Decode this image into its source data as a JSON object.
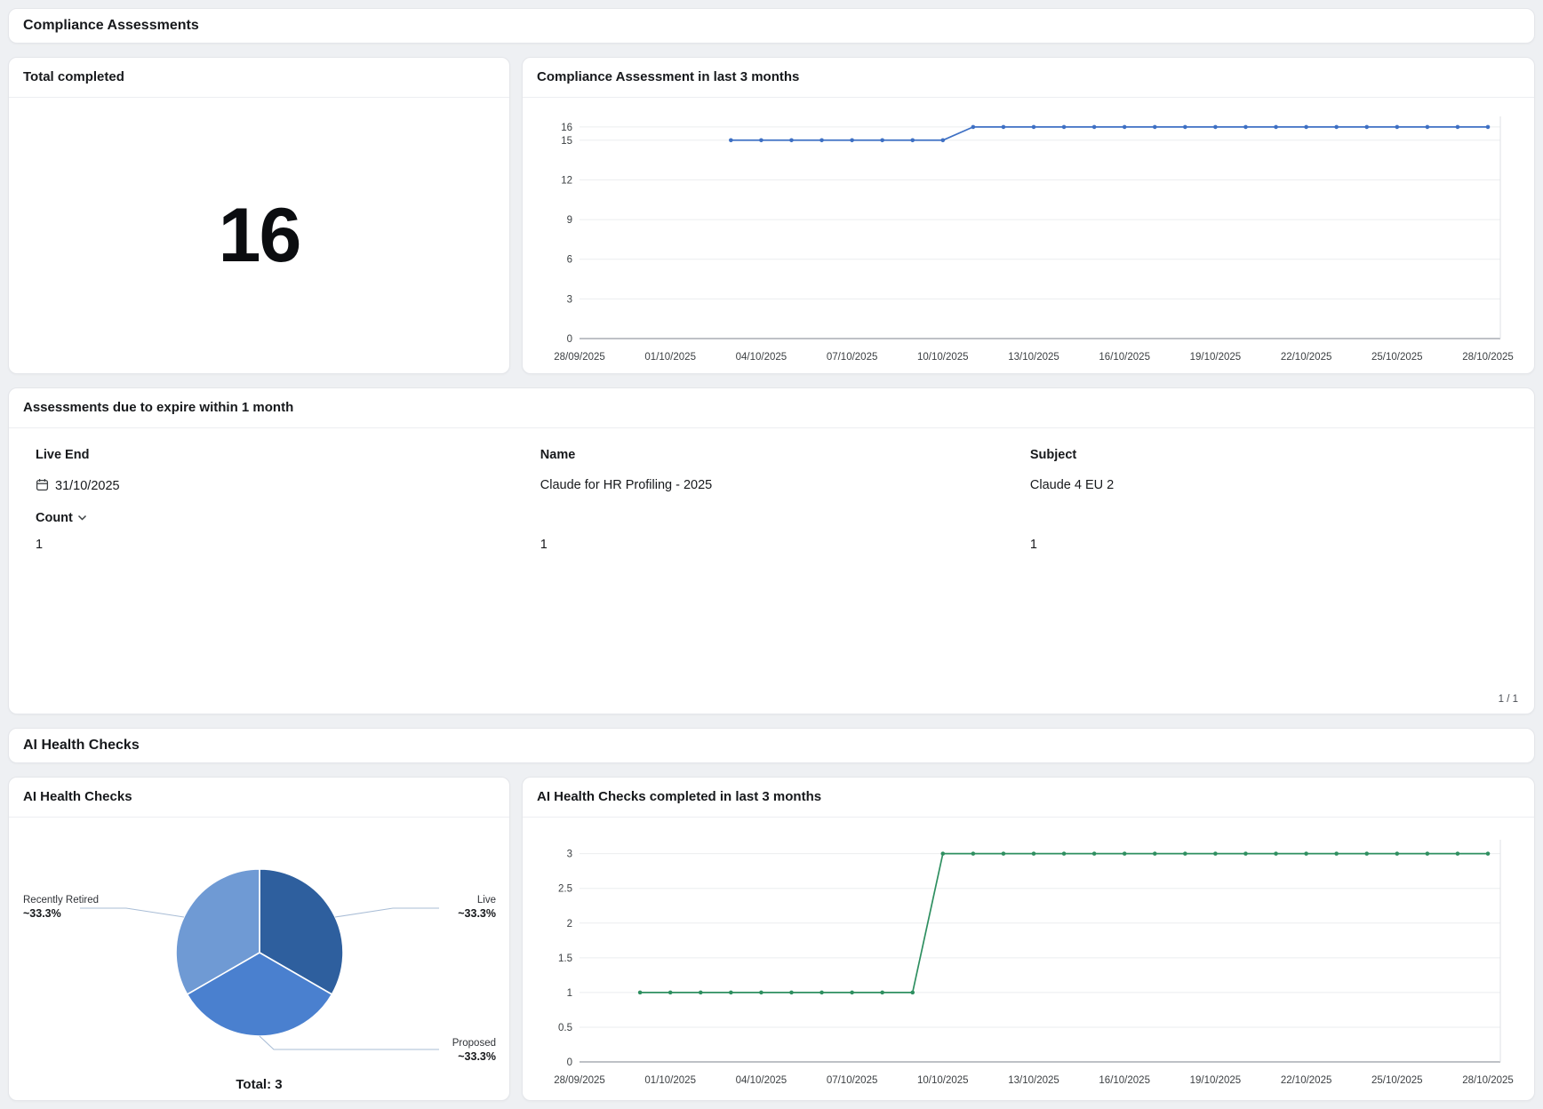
{
  "sections": {
    "compliance": {
      "title": "Compliance Assessments"
    },
    "ai_health": {
      "title": "AI Health Checks"
    }
  },
  "total_completed": {
    "title": "Total completed",
    "value": "16"
  },
  "expiring": {
    "title": "Assessments due to expire within 1 month",
    "columns": [
      "Live End",
      "Name",
      "Subject"
    ],
    "rows": [
      {
        "live_end": "31/10/2025",
        "name": "Claude for HR Profiling - 2025",
        "subject": "Claude 4 EU 2"
      }
    ],
    "count_label": "Count",
    "count_values": [
      "1",
      "1",
      "1"
    ],
    "pagination": "1 / 1"
  },
  "chart_data": [
    {
      "id": "compliance_line",
      "type": "line",
      "title": "Compliance Assessment in last 3 months",
      "color": "#3e70c4",
      "legend": "none",
      "grid": "horizontal",
      "x_tick_labels": [
        "28/09/2025",
        "01/10/2025",
        "04/10/2025",
        "07/10/2025",
        "10/10/2025",
        "13/10/2025",
        "16/10/2025",
        "19/10/2025",
        "22/10/2025",
        "25/10/2025",
        "28/10/2025"
      ],
      "x_tick_days": [
        0,
        3,
        6,
        9,
        12,
        15,
        18,
        21,
        24,
        27,
        30
      ],
      "x_max_day": 30,
      "y_ticks": [
        0,
        3,
        6,
        9,
        12,
        15,
        16
      ],
      "ylim": [
        0,
        16.8
      ],
      "points": [
        [
          5,
          15
        ],
        [
          6,
          15
        ],
        [
          7,
          15
        ],
        [
          8,
          15
        ],
        [
          9,
          15
        ],
        [
          10,
          15
        ],
        [
          11,
          15
        ],
        [
          12,
          15
        ],
        [
          13,
          16
        ],
        [
          14,
          16
        ],
        [
          15,
          16
        ],
        [
          16,
          16
        ],
        [
          17,
          16
        ],
        [
          18,
          16
        ],
        [
          19,
          16
        ],
        [
          20,
          16
        ],
        [
          21,
          16
        ],
        [
          22,
          16
        ],
        [
          23,
          16
        ],
        [
          24,
          16
        ],
        [
          25,
          16
        ],
        [
          26,
          16
        ],
        [
          27,
          16
        ],
        [
          28,
          16
        ],
        [
          29,
          16
        ],
        [
          30,
          16
        ]
      ]
    },
    {
      "id": "health_pie",
      "type": "pie",
      "title": "AI Health Checks",
      "total": 3,
      "total_label": "Total: 3",
      "callout_color": "#a9bdd6",
      "slices": [
        {
          "label": "Live",
          "value": 1,
          "pct_label": "~33.3%",
          "color": "#2e5f9e"
        },
        {
          "label": "Proposed",
          "value": 1,
          "pct_label": "~33.3%",
          "color": "#4a80cf"
        },
        {
          "label": "Recently Retired",
          "value": 1,
          "pct_label": "~33.3%",
          "color": "#6f9ad4"
        }
      ]
    },
    {
      "id": "health_line",
      "type": "line",
      "title": "AI Health Checks completed in last 3 months",
      "color": "#2e8f60",
      "legend": "none",
      "grid": "horizontal",
      "x_tick_labels": [
        "28/09/2025",
        "01/10/2025",
        "04/10/2025",
        "07/10/2025",
        "10/10/2025",
        "13/10/2025",
        "16/10/2025",
        "19/10/2025",
        "22/10/2025",
        "25/10/2025",
        "28/10/2025"
      ],
      "x_tick_days": [
        0,
        3,
        6,
        9,
        12,
        15,
        18,
        21,
        24,
        27,
        30
      ],
      "x_max_day": 30,
      "y_ticks": [
        0,
        0.5,
        1,
        1.5,
        2,
        2.5,
        3
      ],
      "ylim": [
        0,
        3.2
      ],
      "points": [
        [
          2,
          1
        ],
        [
          3,
          1
        ],
        [
          4,
          1
        ],
        [
          5,
          1
        ],
        [
          6,
          1
        ],
        [
          7,
          1
        ],
        [
          8,
          1
        ],
        [
          9,
          1
        ],
        [
          10,
          1
        ],
        [
          11,
          1
        ],
        [
          12,
          3
        ],
        [
          13,
          3
        ],
        [
          14,
          3
        ],
        [
          15,
          3
        ],
        [
          16,
          3
        ],
        [
          17,
          3
        ],
        [
          18,
          3
        ],
        [
          19,
          3
        ],
        [
          20,
          3
        ],
        [
          21,
          3
        ],
        [
          22,
          3
        ],
        [
          23,
          3
        ],
        [
          24,
          3
        ],
        [
          25,
          3
        ],
        [
          26,
          3
        ],
        [
          27,
          3
        ],
        [
          28,
          3
        ],
        [
          29,
          3
        ],
        [
          30,
          3
        ]
      ]
    }
  ]
}
